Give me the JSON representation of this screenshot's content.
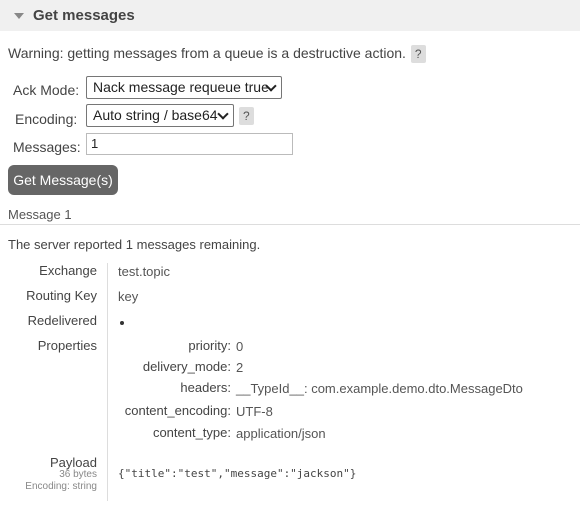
{
  "section": {
    "title": "Get messages"
  },
  "warning": {
    "text": "Warning: getting messages from a queue is a destructive action.",
    "help": "?"
  },
  "form": {
    "ack_mode_label": "Ack Mode:",
    "ack_mode_value": "Nack message requeue true",
    "encoding_label": "Encoding:",
    "encoding_value": "Auto string / base64",
    "encoding_help": "?",
    "messages_label": "Messages:",
    "messages_value": "1",
    "submit_label": "Get Message(s)"
  },
  "message": {
    "heading": "Message 1",
    "reported_prefix": "The server reported ",
    "remaining_count": "1",
    "reported_suffix": " messages remaining.",
    "fields": {
      "exchange_label": "Exchange",
      "exchange_value": "test.topic",
      "routing_key_label": "Routing Key",
      "routing_key_value": "key",
      "redelivered_label": "Redelivered",
      "redelivered_value": true,
      "properties_label": "Properties",
      "payload_label": "Payload",
      "payload_size": "36 bytes",
      "payload_encoding": "Encoding: string",
      "payload_value": "{\"title\":\"test\",\"message\":\"jackson\"}"
    },
    "properties": {
      "priority_label": "priority:",
      "priority_value": "0",
      "delivery_mode_label": "delivery_mode:",
      "delivery_mode_value": "2",
      "headers_label": "headers:",
      "header_key": "__TypeId__:",
      "header_value": "com.example.demo.dto.MessageDto",
      "content_encoding_label": "content_encoding:",
      "content_encoding_value": "UTF-8",
      "content_type_label": "content_type:",
      "content_type_value": "application/json"
    }
  },
  "colors": {
    "header_bg": "#f0f0f0",
    "button_bg": "#666666",
    "help_bg": "#dddddd"
  }
}
